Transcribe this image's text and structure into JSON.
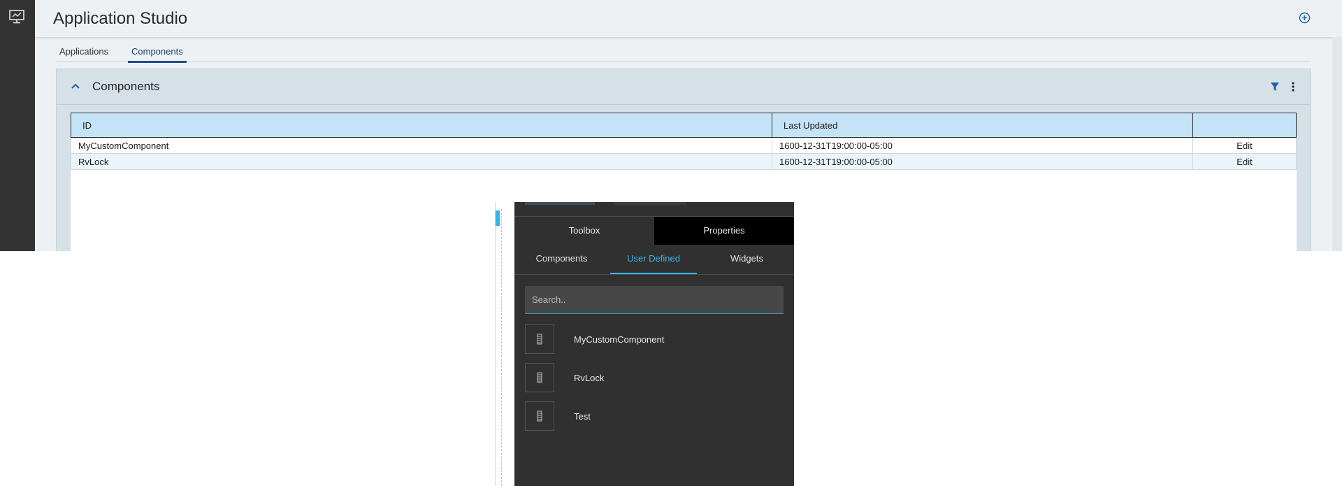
{
  "header": {
    "title": "Application Studio",
    "add_icon": "plus-circle-icon",
    "rail_icon": "monitor-icon"
  },
  "tabs": [
    {
      "label": "Applications",
      "active": false
    },
    {
      "label": "Components",
      "active": true
    }
  ],
  "panel": {
    "title": "Components",
    "collapse_icon": "chevron-up-icon",
    "filter_icon": "filter-icon",
    "menu_icon": "kebab-icon"
  },
  "table": {
    "columns": [
      "ID",
      "Last Updated",
      ""
    ],
    "rows": [
      {
        "id": "MyCustomComponent",
        "updated": "1600-12-31T19:00:00-05:00",
        "action": "Edit"
      },
      {
        "id": "RvLock",
        "updated": "1600-12-31T19:00:00-05:00",
        "action": "Edit"
      }
    ]
  },
  "toolbox": {
    "tabs": [
      "Toolbox",
      "Properties"
    ],
    "subtabs": [
      "Components",
      "User Defined",
      "Widgets"
    ],
    "active_subtab": "User Defined",
    "search_placeholder": "Search..",
    "items": [
      {
        "label": "MyCustomComponent",
        "icon": "component-icon"
      },
      {
        "label": "RvLock",
        "icon": "component-icon"
      },
      {
        "label": "Test",
        "icon": "component-icon"
      }
    ]
  },
  "colors": {
    "accent": "#37b7ec",
    "table_header": "#c5e3f6",
    "rail": "#333333",
    "tab_active": "#1b4f87"
  }
}
